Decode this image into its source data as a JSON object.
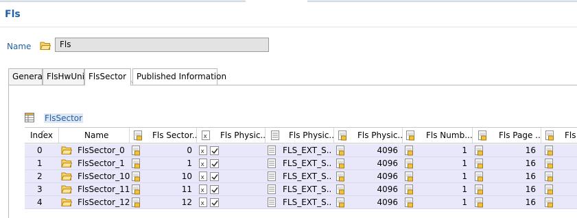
{
  "page": {
    "title": "Fls"
  },
  "name_field": {
    "label": "Name",
    "value": "Fls"
  },
  "tabs": [
    {
      "label": "General"
    },
    {
      "label": "FlsHwUnit"
    },
    {
      "label": "FlsSector"
    },
    {
      "label": "Published Information"
    }
  ],
  "section": {
    "label": "FlsSector"
  },
  "table": {
    "columns": [
      "Index",
      "Name",
      "Fls Sector...",
      "Fls Physic...",
      "Fls Physic...",
      "Fls Physic...",
      "Fls Numb...",
      "Fls Page ...",
      "Fls S"
    ],
    "rows": [
      {
        "index": "0",
        "name": "FlsSector_0",
        "sector": "0",
        "physic2": "FLS_EXT_S...",
        "physic3": "4096",
        "numb": "1",
        "page": "16"
      },
      {
        "index": "1",
        "name": "FlsSector_1",
        "sector": "1",
        "physic2": "FLS_EXT_S...",
        "physic3": "4096",
        "numb": "1",
        "page": "16"
      },
      {
        "index": "2",
        "name": "FlsSector_10",
        "sector": "10",
        "physic2": "FLS_EXT_S...",
        "physic3": "4096",
        "numb": "1",
        "page": "16"
      },
      {
        "index": "3",
        "name": "FlsSector_11",
        "sector": "11",
        "physic2": "FLS_EXT_S...",
        "physic3": "4096",
        "numb": "1",
        "page": "16"
      },
      {
        "index": "4",
        "name": "FlsSector_12",
        "sector": "12",
        "physic2": "FLS_EXT_S...",
        "physic3": "4096",
        "numb": "1",
        "page": "16"
      }
    ]
  },
  "icons": {
    "folder": "folder-icon",
    "integer": "integer-param-icon",
    "boolean": "boolean-param-icon",
    "text": "text-param-icon",
    "table": "table-icon"
  },
  "colors": {
    "accent": "#1f5fa8",
    "row_bg": "#e8e8fa",
    "selection_bg": "#dfe7f3"
  }
}
